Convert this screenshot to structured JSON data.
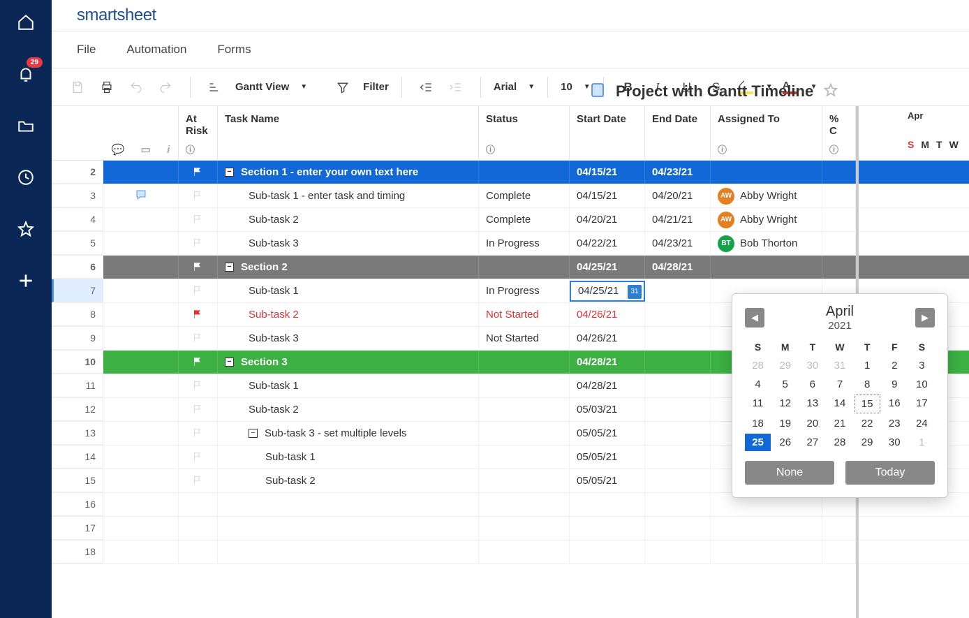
{
  "rail": {
    "badge": "29"
  },
  "logo": "smartsheet",
  "menu": {
    "file": "File",
    "automation": "Automation",
    "forms": "Forms"
  },
  "document": {
    "title": "Project with Gantt Timeline"
  },
  "toolbar": {
    "view": "Gantt View",
    "filter": "Filter",
    "font": "Arial",
    "size": "10"
  },
  "columns": {
    "risk": "At Risk",
    "task": "Task Name",
    "status": "Status",
    "start": "Start Date",
    "end": "End Date",
    "assigned": "Assigned To",
    "pct": "% C"
  },
  "timeline": {
    "month": "Apr",
    "days": [
      "S",
      "M",
      "T",
      "W"
    ]
  },
  "rows": [
    {
      "n": "2",
      "type": "section1",
      "task": "Section 1 - enter your own text here",
      "start": "04/15/21",
      "end": "04/23/21"
    },
    {
      "n": "3",
      "type": "sub",
      "comment": true,
      "task": "Sub-task 1 - enter task and timing",
      "status": "Complete",
      "start": "04/15/21",
      "end": "04/20/21",
      "assignee": "Abby Wright",
      "initials": "AW",
      "avclass": "av-orange"
    },
    {
      "n": "4",
      "type": "sub",
      "task": "Sub-task 2",
      "status": "Complete",
      "start": "04/20/21",
      "end": "04/21/21",
      "assignee": "Abby Wright",
      "initials": "AW",
      "avclass": "av-orange"
    },
    {
      "n": "5",
      "type": "sub",
      "task": "Sub-task 3",
      "status": "In Progress",
      "start": "04/22/21",
      "end": "04/23/21",
      "assignee": "Bob Thorton",
      "initials": "BT",
      "avclass": "av-green"
    },
    {
      "n": "6",
      "type": "section2",
      "task": "Section 2",
      "start": "04/25/21",
      "end": "04/28/21"
    },
    {
      "n": "7",
      "type": "sub",
      "task": "Sub-task 1",
      "status": "In Progress",
      "start": "04/25/21",
      "active": true
    },
    {
      "n": "8",
      "type": "sub",
      "red": true,
      "flagred": true,
      "task": "Sub-task 2",
      "status": "Not Started",
      "start": "04/26/21"
    },
    {
      "n": "9",
      "type": "sub",
      "task": "Sub-task 3",
      "status": "Not Started",
      "start": "04/26/21"
    },
    {
      "n": "10",
      "type": "section3",
      "task": "Section 3",
      "start": "04/28/21"
    },
    {
      "n": "11",
      "type": "sub",
      "task": "Sub-task 1",
      "start": "04/28/21"
    },
    {
      "n": "12",
      "type": "sub",
      "task": "Sub-task 2",
      "start": "05/03/21"
    },
    {
      "n": "13",
      "type": "sub",
      "expand": true,
      "task": "Sub-task 3 - set multiple levels",
      "start": "05/05/21"
    },
    {
      "n": "14",
      "type": "sub",
      "indent": 3,
      "task": "Sub-task 1",
      "start": "05/05/21"
    },
    {
      "n": "15",
      "type": "sub",
      "indent": 3,
      "task": "Sub-task 2",
      "start": "05/05/21"
    },
    {
      "n": "16",
      "type": "empty"
    },
    {
      "n": "17",
      "type": "empty"
    },
    {
      "n": "18",
      "type": "empty"
    }
  ],
  "datepicker": {
    "month": "April",
    "year": "2021",
    "dow": [
      "S",
      "M",
      "T",
      "W",
      "T",
      "F",
      "S"
    ],
    "weeks": [
      [
        {
          "d": "28",
          "o": true
        },
        {
          "d": "29",
          "o": true
        },
        {
          "d": "30",
          "o": true
        },
        {
          "d": "31",
          "o": true
        },
        {
          "d": "1"
        },
        {
          "d": "2"
        },
        {
          "d": "3"
        }
      ],
      [
        {
          "d": "4"
        },
        {
          "d": "5"
        },
        {
          "d": "6"
        },
        {
          "d": "7"
        },
        {
          "d": "8"
        },
        {
          "d": "9"
        },
        {
          "d": "10"
        }
      ],
      [
        {
          "d": "11"
        },
        {
          "d": "12"
        },
        {
          "d": "13"
        },
        {
          "d": "14"
        },
        {
          "d": "15",
          "today": true
        },
        {
          "d": "16"
        },
        {
          "d": "17"
        }
      ],
      [
        {
          "d": "18"
        },
        {
          "d": "19"
        },
        {
          "d": "20"
        },
        {
          "d": "21"
        },
        {
          "d": "22"
        },
        {
          "d": "23"
        },
        {
          "d": "24"
        }
      ],
      [
        {
          "d": "25",
          "sel": true
        },
        {
          "d": "26"
        },
        {
          "d": "27"
        },
        {
          "d": "28"
        },
        {
          "d": "29"
        },
        {
          "d": "30"
        },
        {
          "d": "1",
          "o": true
        }
      ]
    ],
    "none": "None",
    "today": "Today"
  }
}
